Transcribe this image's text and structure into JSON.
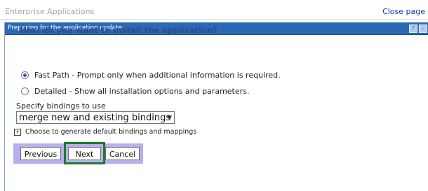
{
  "header": {
    "app_title": "Enterprise Applications",
    "close_label": "Close page"
  },
  "panel": {
    "title": "Preparing for the application update",
    "help_icon": "?",
    "minimize_icon": "-"
  },
  "question": "How do you want to install the application?",
  "options": [
    {
      "label": "Fast Path - Prompt only when additional information is required.",
      "selected": true
    },
    {
      "label": "Detailed - Show all installation options and parameters.",
      "selected": false
    }
  ],
  "bindings": {
    "label": "Specify bindings to use",
    "selected": "merge new and existing bindings"
  },
  "generate_defaults": {
    "toggle": "+",
    "label": "Choose to generate default bindings and mappings"
  },
  "buttons": {
    "previous": "Previous",
    "next": "Next",
    "cancel": "Cancel"
  },
  "colors": {
    "header_bg": "#2b69b4",
    "accent_text": "#31478c",
    "button_group_bg": "#b7b0f0",
    "highlight_border": "#1f7a2a"
  }
}
